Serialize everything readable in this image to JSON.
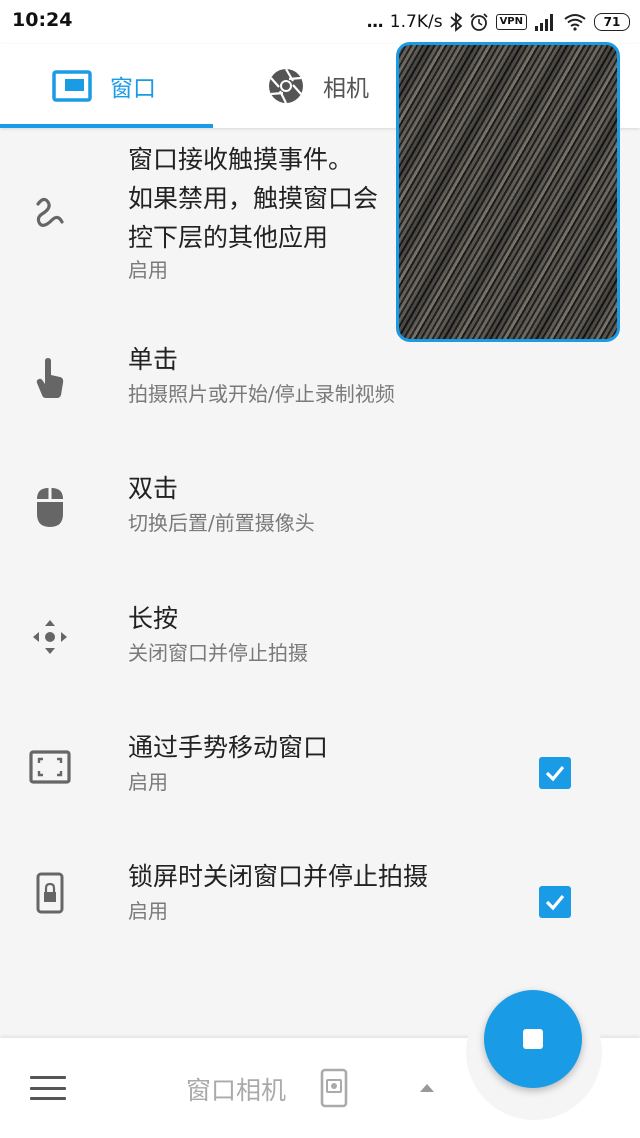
{
  "status_bar": {
    "time": "10:24",
    "dots": "...",
    "speed": "1.7K/s",
    "vpn": "VPN",
    "battery": "71"
  },
  "tabs": [
    {
      "label": "窗口",
      "selected": true
    },
    {
      "label": "相机",
      "selected": false
    }
  ],
  "items": [
    {
      "title": "窗口接收触摸事件。\n如果禁用，触摸窗口会\n控下层的其他应用",
      "subtitle": "启用",
      "icon": "gesture-icon",
      "checked": null
    },
    {
      "title": "单击",
      "subtitle": "拍摄照片或开始/停止录制视频",
      "icon": "touch-icon",
      "checked": null
    },
    {
      "title": "双击",
      "subtitle": "切换后置/前置摄像头",
      "icon": "mouse-icon",
      "checked": null
    },
    {
      "title": "长按",
      "subtitle": "关闭窗口并停止拍摄",
      "icon": "move-icon",
      "checked": null
    },
    {
      "title": "通过手势移动窗口",
      "subtitle": "启用",
      "icon": "fullscreen-icon",
      "checked": true
    },
    {
      "title": "锁屏时关闭窗口并停止拍摄",
      "subtitle": "启用",
      "icon": "lock-phone-icon",
      "checked": true
    }
  ],
  "bottom_bar": {
    "app_title": "窗口相机"
  },
  "colors": {
    "accent": "#1a9be6",
    "background": "#f5f5f5"
  }
}
